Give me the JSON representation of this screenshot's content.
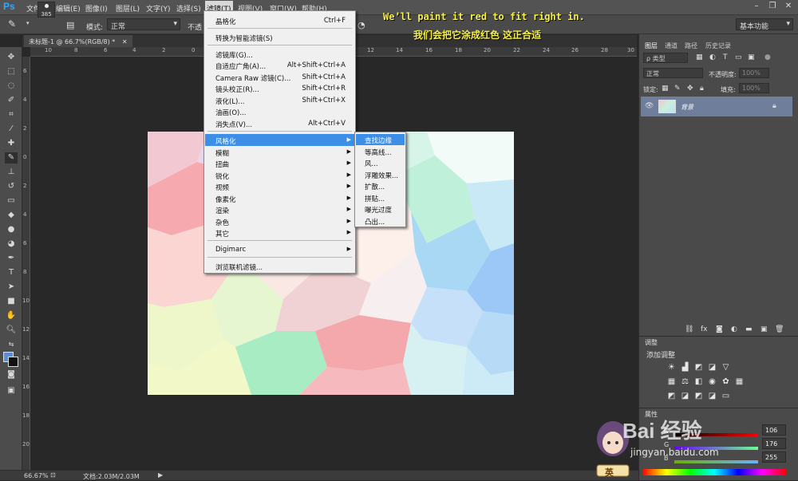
{
  "app": {
    "logo": "Ps"
  },
  "menubar": {
    "items": [
      "文件(F)",
      "编辑(E)",
      "图像(I)",
      "图层(L)",
      "文字(Y)",
      "选择(S)",
      "滤镜(T)",
      "视图(V)",
      "窗口(W)",
      "帮助(H)"
    ],
    "active": "滤镜(T)"
  },
  "options": {
    "brush_size": "385",
    "mode_label": "模式:",
    "mode_value": "正常",
    "opacity_label": "不透",
    "workspace": "基本功能"
  },
  "caption": {
    "en": "We’ll paint it red to fit right in.",
    "zh": "我们会把它涂成红色 这正合适"
  },
  "document": {
    "tab_title": "未标题-1 @ 66.7%(RGB/8) *"
  },
  "ruler_top": [
    "10",
    "8",
    "6",
    "4",
    "2",
    "0",
    "2",
    "4",
    "6",
    "8",
    "10",
    "12",
    "14",
    "16",
    "18",
    "20",
    "22",
    "24",
    "26",
    "28",
    "30"
  ],
  "ruler_left": [
    "6",
    "4",
    "2",
    "0",
    "2",
    "4",
    "6",
    "8",
    "10",
    "12",
    "14",
    "16",
    "18",
    "20",
    "22",
    "24"
  ],
  "filter_menu": {
    "items": [
      {
        "label": "晶格化",
        "shortcut": "Ctrl+F"
      },
      {
        "label": "转换为智能滤镜(S)",
        "shortcut": ""
      },
      {
        "label": "滤镜库(G)...",
        "shortcut": ""
      },
      {
        "label": "自适应广角(A)...",
        "shortcut": "Alt+Shift+Ctrl+A"
      },
      {
        "label": "Camera Raw 滤镜(C)...",
        "shortcut": "Shift+Ctrl+A"
      },
      {
        "label": "镜头校正(R)...",
        "shortcut": "Shift+Ctrl+R"
      },
      {
        "label": "液化(L)...",
        "shortcut": "Shift+Ctrl+X"
      },
      {
        "label": "油画(O)...",
        "shortcut": ""
      },
      {
        "label": "消失点(V)...",
        "shortcut": "Alt+Ctrl+V"
      },
      {
        "label": "风格化",
        "shortcut": ""
      },
      {
        "label": "模糊",
        "shortcut": ""
      },
      {
        "label": "扭曲",
        "shortcut": ""
      },
      {
        "label": "锐化",
        "shortcut": ""
      },
      {
        "label": "视频",
        "shortcut": ""
      },
      {
        "label": "像素化",
        "shortcut": ""
      },
      {
        "label": "渲染",
        "shortcut": ""
      },
      {
        "label": "杂色",
        "shortcut": ""
      },
      {
        "label": "其它",
        "shortcut": ""
      },
      {
        "label": "Digimarc",
        "shortcut": ""
      },
      {
        "label": "浏览联机滤镜...",
        "shortcut": ""
      }
    ],
    "highlighted": "风格化"
  },
  "stylize_submenu": {
    "items": [
      "查找边缘",
      "等高线...",
      "风...",
      "浮雕效果...",
      "扩散...",
      "拼贴...",
      "曝光过度",
      "凸出..."
    ],
    "highlighted": "查找边缘"
  },
  "layers_panel": {
    "tabs": [
      "图层",
      "通道",
      "路径",
      "历史记录"
    ],
    "filter_kind": "ρ 类型",
    "blend_mode": "正常",
    "opacity_label": "不透明度:",
    "opacity_value": "100%",
    "lock_label": "锁定:",
    "fill_label": "填充:",
    "fill_value": "100%",
    "layer_name": "背景"
  },
  "adjustments_panel": {
    "tab": "调整",
    "title": "添加调整"
  },
  "properties_panel": {
    "tab": "属性",
    "channels": [
      {
        "label": "R",
        "value": "106"
      },
      {
        "label": "G",
        "value": "176"
      },
      {
        "label": "B",
        "value": "255"
      }
    ]
  },
  "status": {
    "zoom": "66.67%",
    "doc_info": "文档:2.03M/2.03M"
  },
  "watermark": {
    "text": "Bai 经验",
    "url": "jingyan.baidu.com",
    "badge": "英"
  },
  "colors": {
    "foreground": "#5b8ed6",
    "background": "#111111",
    "highlight": "#3d8ee7"
  }
}
